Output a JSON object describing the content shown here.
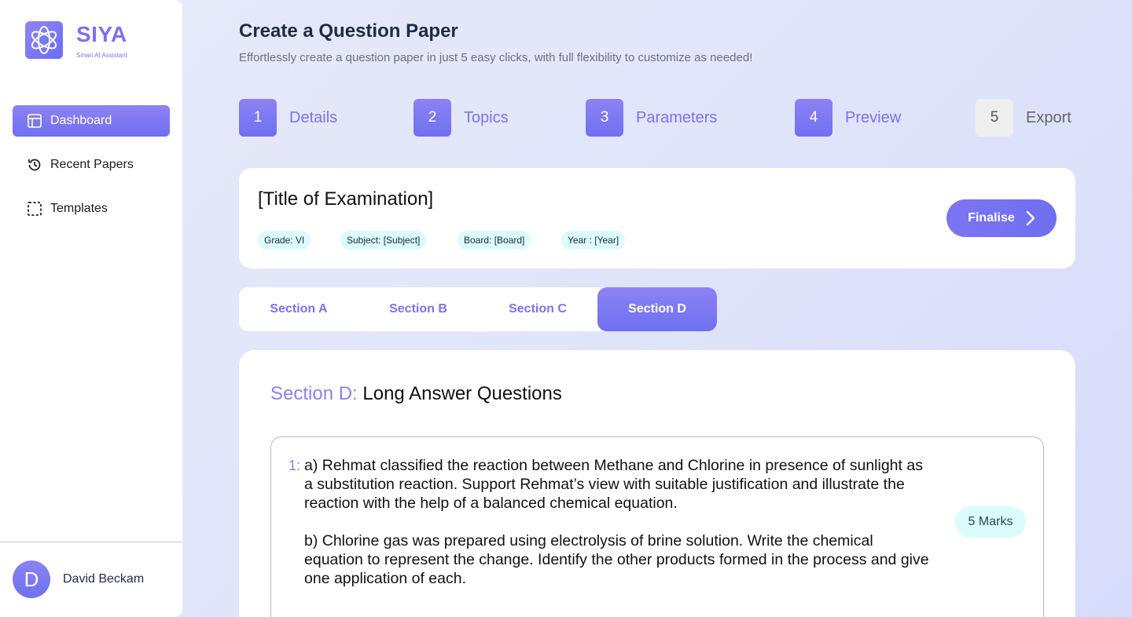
{
  "brand": {
    "name": "SIYA",
    "tagline": "Smart AI Assistant"
  },
  "sidebar": {
    "items": [
      {
        "label": "Dashboard",
        "icon": "layout-icon",
        "active": true
      },
      {
        "label": "Recent Papers",
        "icon": "history-icon",
        "active": false
      },
      {
        "label": "Templates",
        "icon": "dashed-square-icon",
        "active": false
      }
    ],
    "user": {
      "initial": "D",
      "name": "David Beckam"
    }
  },
  "header": {
    "title": "Create a Question Paper",
    "subtitle": "Effortlessly create a question paper in just 5 easy clicks, with full flexibility to customize as needed!"
  },
  "steps": [
    {
      "num": "1",
      "label": "Details",
      "done": true
    },
    {
      "num": "2",
      "label": "Topics",
      "done": true
    },
    {
      "num": "3",
      "label": "Parameters",
      "done": true
    },
    {
      "num": "4",
      "label": "Preview",
      "done": true
    },
    {
      "num": "5",
      "label": "Export",
      "done": false
    }
  ],
  "exam": {
    "title": "[Title of Examination]",
    "tags": [
      "Grade: VI",
      "Subject: [Subject]",
      "Board: [Board]",
      "Year : [Year]"
    ],
    "finalise_label": "Finalise"
  },
  "sections": {
    "tabs": [
      "Section A",
      "Section B",
      "Section C",
      "Section D"
    ],
    "active": "Section D",
    "heading_prefix": "Section D:",
    "heading_rest": "Long Answer Questions"
  },
  "question": {
    "number": "1:",
    "part_a": "a) Rehmat classified the reaction between Methane and Chlorine in presence of sunlight as a substitution reaction. Support Rehmat’s view with suitable justification and illustrate the reaction with the help of a balanced chemical equation.",
    "part_b": "b) Chlorine gas was prepared using electrolysis of brine solution. Write the chemical equation to represent the change. Identify the other products formed in the process and give one application of each.",
    "marks": "5 Marks"
  },
  "colors": {
    "accent": "#7b72ee",
    "tag_bg": "#dcfbfb",
    "background": "#e3e8f9"
  }
}
